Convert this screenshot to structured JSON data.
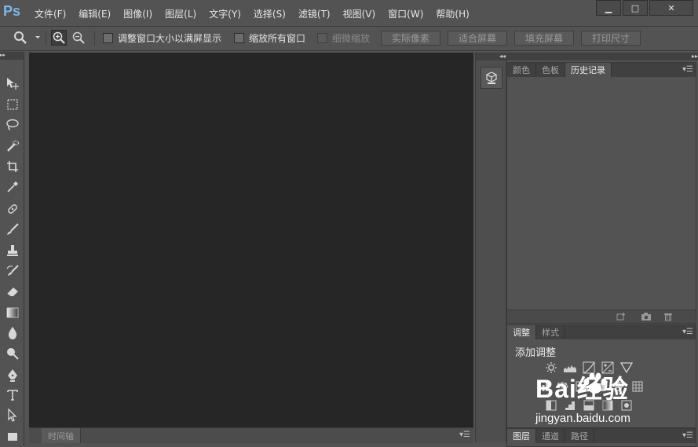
{
  "app": {
    "logo_text": "Ps"
  },
  "menu": {
    "items": [
      "文件(F)",
      "编辑(E)",
      "图像(I)",
      "图层(L)",
      "文字(Y)",
      "选择(S)",
      "滤镜(T)",
      "视图(V)",
      "窗口(W)",
      "帮助(H)"
    ]
  },
  "window_controls": {
    "minimize": "▁",
    "maximize": "□",
    "close": "✕"
  },
  "options_bar": {
    "resize_windows_label": "调整窗口大小以满屏显示",
    "zoom_all_windows_label": "缩放所有窗口",
    "scrubby_zoom_label": "细微缩放",
    "actual_pixels_label": "实际像素",
    "fit_screen_label": "适合屏幕",
    "fill_screen_label": "填充屏幕",
    "print_size_label": "打印尺寸"
  },
  "timeline": {
    "tab_label": "时间轴"
  },
  "history_panel": {
    "tabs": [
      "颜色",
      "色板",
      "历史记录"
    ],
    "active_tab": "历史记录"
  },
  "adjustments_panel": {
    "tabs": [
      "调整",
      "样式"
    ],
    "active_tab": "调整",
    "title": "添加调整"
  },
  "layers_panel": {
    "tabs": [
      "图层",
      "通道",
      "路径"
    ],
    "active_tab": "图层"
  },
  "watermark": {
    "brand": "Bai经验",
    "site": "jingyan.baidu.com"
  },
  "colors": {
    "accent_logo": "#7fb6e8",
    "canvas_bg": "#262626",
    "panel_bg": "#535353"
  }
}
